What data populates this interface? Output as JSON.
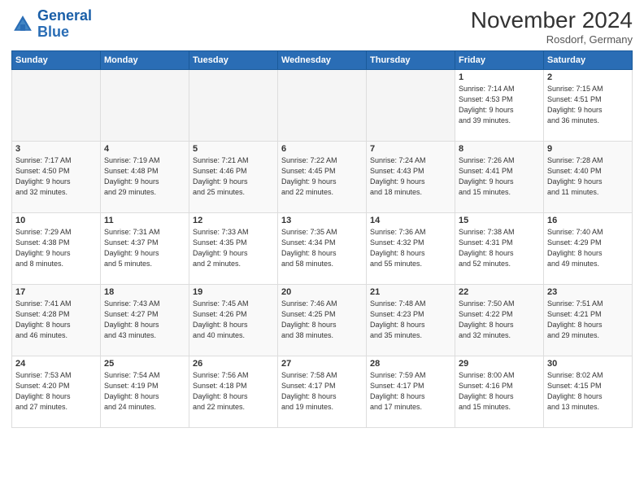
{
  "header": {
    "logo_line1": "General",
    "logo_line2": "Blue",
    "month": "November 2024",
    "location": "Rosdorf, Germany"
  },
  "days_of_week": [
    "Sunday",
    "Monday",
    "Tuesday",
    "Wednesday",
    "Thursday",
    "Friday",
    "Saturday"
  ],
  "weeks": [
    [
      {
        "day": "",
        "info": ""
      },
      {
        "day": "",
        "info": ""
      },
      {
        "day": "",
        "info": ""
      },
      {
        "day": "",
        "info": ""
      },
      {
        "day": "",
        "info": ""
      },
      {
        "day": "1",
        "info": "Sunrise: 7:14 AM\nSunset: 4:53 PM\nDaylight: 9 hours\nand 39 minutes."
      },
      {
        "day": "2",
        "info": "Sunrise: 7:15 AM\nSunset: 4:51 PM\nDaylight: 9 hours\nand 36 minutes."
      }
    ],
    [
      {
        "day": "3",
        "info": "Sunrise: 7:17 AM\nSunset: 4:50 PM\nDaylight: 9 hours\nand 32 minutes."
      },
      {
        "day": "4",
        "info": "Sunrise: 7:19 AM\nSunset: 4:48 PM\nDaylight: 9 hours\nand 29 minutes."
      },
      {
        "day": "5",
        "info": "Sunrise: 7:21 AM\nSunset: 4:46 PM\nDaylight: 9 hours\nand 25 minutes."
      },
      {
        "day": "6",
        "info": "Sunrise: 7:22 AM\nSunset: 4:45 PM\nDaylight: 9 hours\nand 22 minutes."
      },
      {
        "day": "7",
        "info": "Sunrise: 7:24 AM\nSunset: 4:43 PM\nDaylight: 9 hours\nand 18 minutes."
      },
      {
        "day": "8",
        "info": "Sunrise: 7:26 AM\nSunset: 4:41 PM\nDaylight: 9 hours\nand 15 minutes."
      },
      {
        "day": "9",
        "info": "Sunrise: 7:28 AM\nSunset: 4:40 PM\nDaylight: 9 hours\nand 11 minutes."
      }
    ],
    [
      {
        "day": "10",
        "info": "Sunrise: 7:29 AM\nSunset: 4:38 PM\nDaylight: 9 hours\nand 8 minutes."
      },
      {
        "day": "11",
        "info": "Sunrise: 7:31 AM\nSunset: 4:37 PM\nDaylight: 9 hours\nand 5 minutes."
      },
      {
        "day": "12",
        "info": "Sunrise: 7:33 AM\nSunset: 4:35 PM\nDaylight: 9 hours\nand 2 minutes."
      },
      {
        "day": "13",
        "info": "Sunrise: 7:35 AM\nSunset: 4:34 PM\nDaylight: 8 hours\nand 58 minutes."
      },
      {
        "day": "14",
        "info": "Sunrise: 7:36 AM\nSunset: 4:32 PM\nDaylight: 8 hours\nand 55 minutes."
      },
      {
        "day": "15",
        "info": "Sunrise: 7:38 AM\nSunset: 4:31 PM\nDaylight: 8 hours\nand 52 minutes."
      },
      {
        "day": "16",
        "info": "Sunrise: 7:40 AM\nSunset: 4:29 PM\nDaylight: 8 hours\nand 49 minutes."
      }
    ],
    [
      {
        "day": "17",
        "info": "Sunrise: 7:41 AM\nSunset: 4:28 PM\nDaylight: 8 hours\nand 46 minutes."
      },
      {
        "day": "18",
        "info": "Sunrise: 7:43 AM\nSunset: 4:27 PM\nDaylight: 8 hours\nand 43 minutes."
      },
      {
        "day": "19",
        "info": "Sunrise: 7:45 AM\nSunset: 4:26 PM\nDaylight: 8 hours\nand 40 minutes."
      },
      {
        "day": "20",
        "info": "Sunrise: 7:46 AM\nSunset: 4:25 PM\nDaylight: 8 hours\nand 38 minutes."
      },
      {
        "day": "21",
        "info": "Sunrise: 7:48 AM\nSunset: 4:23 PM\nDaylight: 8 hours\nand 35 minutes."
      },
      {
        "day": "22",
        "info": "Sunrise: 7:50 AM\nSunset: 4:22 PM\nDaylight: 8 hours\nand 32 minutes."
      },
      {
        "day": "23",
        "info": "Sunrise: 7:51 AM\nSunset: 4:21 PM\nDaylight: 8 hours\nand 29 minutes."
      }
    ],
    [
      {
        "day": "24",
        "info": "Sunrise: 7:53 AM\nSunset: 4:20 PM\nDaylight: 8 hours\nand 27 minutes."
      },
      {
        "day": "25",
        "info": "Sunrise: 7:54 AM\nSunset: 4:19 PM\nDaylight: 8 hours\nand 24 minutes."
      },
      {
        "day": "26",
        "info": "Sunrise: 7:56 AM\nSunset: 4:18 PM\nDaylight: 8 hours\nand 22 minutes."
      },
      {
        "day": "27",
        "info": "Sunrise: 7:58 AM\nSunset: 4:17 PM\nDaylight: 8 hours\nand 19 minutes."
      },
      {
        "day": "28",
        "info": "Sunrise: 7:59 AM\nSunset: 4:17 PM\nDaylight: 8 hours\nand 17 minutes."
      },
      {
        "day": "29",
        "info": "Sunrise: 8:00 AM\nSunset: 4:16 PM\nDaylight: 8 hours\nand 15 minutes."
      },
      {
        "day": "30",
        "info": "Sunrise: 8:02 AM\nSunset: 4:15 PM\nDaylight: 8 hours\nand 13 minutes."
      }
    ]
  ]
}
